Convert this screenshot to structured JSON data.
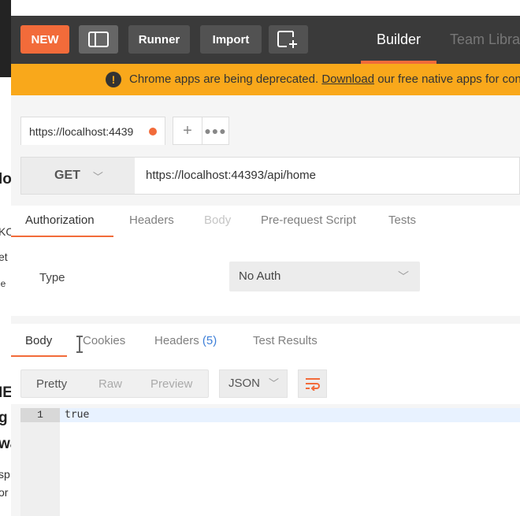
{
  "background_window": {
    "fragments": [
      "lo",
      "KO",
      "et",
      "le",
      "IE",
      "g",
      "wa",
      "sp",
      "or"
    ]
  },
  "header": {
    "new_label": "NEW",
    "runner_label": "Runner",
    "import_label": "Import",
    "tabs": [
      {
        "label": "Builder",
        "active": true
      },
      {
        "label": "Team Libra",
        "active": false
      }
    ]
  },
  "banner": {
    "icon": "exclamation-icon",
    "text_before": "Chrome apps are being deprecated. ",
    "link": "Download",
    "text_after": " our free native apps for cont"
  },
  "request_tab": {
    "title": "https://localhost:4439",
    "unsaved": true
  },
  "request": {
    "method": "GET",
    "url": "https://localhost:44393/api/home"
  },
  "request_tabs": [
    "Authorization",
    "Headers",
    "Body",
    "Pre-request Script",
    "Tests"
  ],
  "auth": {
    "type_label": "Type",
    "type_value": "No Auth"
  },
  "response_tabs": {
    "body": "Body",
    "cookies": "Cookies",
    "headers": "Headers",
    "headers_count": "(5)",
    "test_results": "Test Results"
  },
  "response_view": {
    "modes": [
      "Pretty",
      "Raw",
      "Preview"
    ],
    "active_mode": "Pretty",
    "format": "JSON"
  },
  "response_body": {
    "line_number": "1",
    "content": "true"
  },
  "colors": {
    "accent": "#f26b3a",
    "header_bg": "#3a3a3a",
    "banner_bg": "#f9a81b",
    "count_blue": "#3d7fd8"
  }
}
